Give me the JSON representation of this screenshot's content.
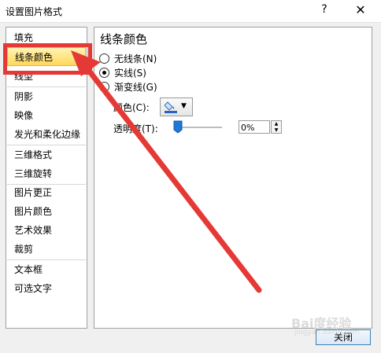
{
  "window": {
    "title": "设置图片格式",
    "help": "?",
    "close": "✕"
  },
  "sidebar": {
    "items": [
      {
        "label": "填充"
      },
      {
        "label": "线条颜色",
        "selected": true
      },
      {
        "label": "线型"
      },
      {
        "label": "阴影"
      },
      {
        "label": "映像"
      },
      {
        "label": "发光和柔化边缘"
      },
      {
        "label": "三维格式"
      },
      {
        "label": "三维旋转"
      },
      {
        "label": "图片更正"
      },
      {
        "label": "图片颜色"
      },
      {
        "label": "艺术效果"
      },
      {
        "label": "裁剪"
      },
      {
        "label": "文本框"
      },
      {
        "label": "可选文字"
      }
    ]
  },
  "panel": {
    "title": "线条颜色",
    "options": {
      "no_line": "无线条(N)",
      "solid_line": "实线(S)",
      "gradient_line": "渐变线(G)",
      "selected": "solid_line"
    },
    "color_label": "颜色(C):",
    "transparency_label": "透明度(T):",
    "transparency_value": "0%",
    "transparency_level": 0
  },
  "footer": {
    "close_label": "关闭"
  },
  "watermark": {
    "line1": "Bai度经验",
    "line2": "jingyan.baidu.com"
  },
  "colors": {
    "annotation": "#e53935",
    "selection": "#ffd85a",
    "panel_bg": "#ffffff"
  }
}
